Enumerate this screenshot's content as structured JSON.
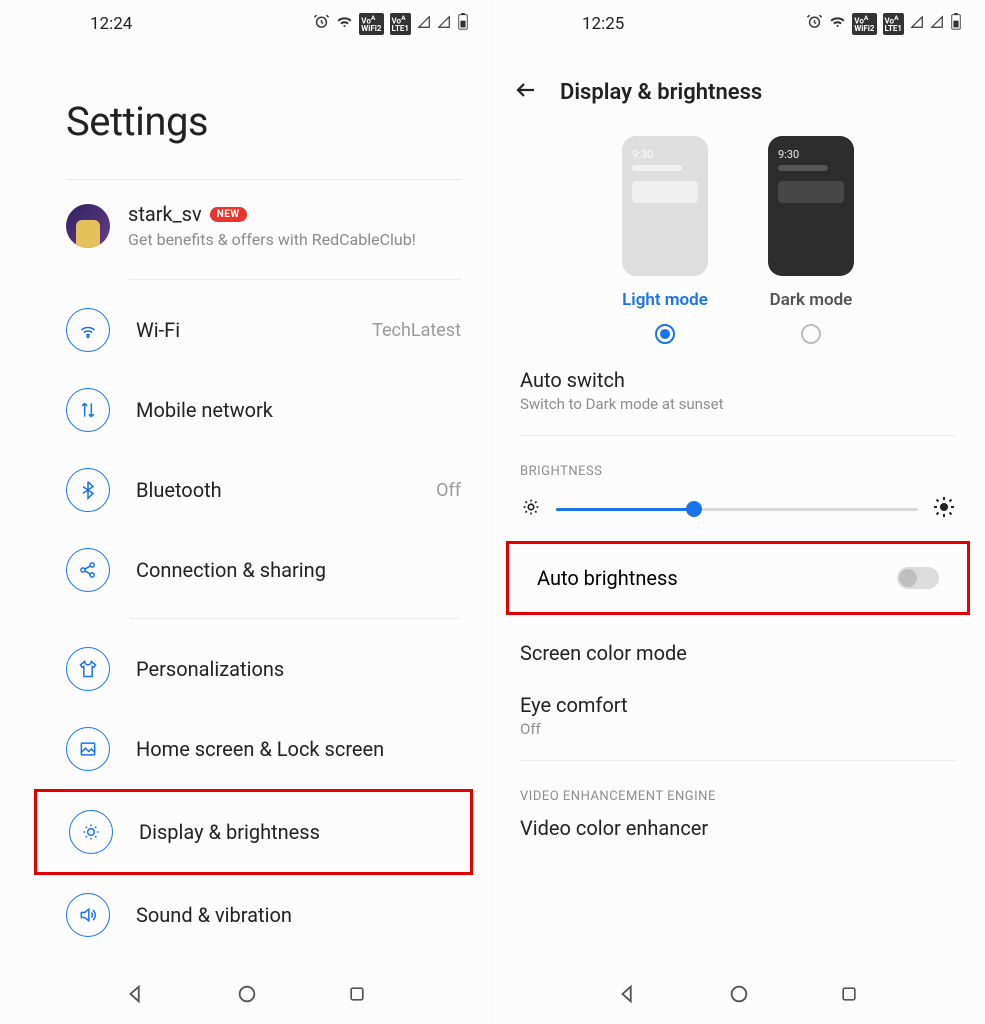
{
  "left": {
    "statusbar": {
      "time": "12:24",
      "badge1": "Vo^\nWiFi2",
      "badge2": "Vo^\nLTE1"
    },
    "title": "Settings",
    "account": {
      "username": "stark_sv",
      "new_badge": "NEW",
      "subtitle": "Get benefits & offers with RedCableClub!"
    },
    "items": [
      {
        "label": "Wi-Fi",
        "value": "TechLatest"
      },
      {
        "label": "Mobile network",
        "value": ""
      },
      {
        "label": "Bluetooth",
        "value": "Off"
      },
      {
        "label": "Connection & sharing",
        "value": ""
      },
      {
        "label": "Personalizations",
        "value": ""
      },
      {
        "label": "Home screen & Lock screen",
        "value": ""
      },
      {
        "label": "Display & brightness",
        "value": ""
      },
      {
        "label": "Sound & vibration",
        "value": ""
      }
    ]
  },
  "right": {
    "statusbar": {
      "time": "12:25",
      "badge1": "Vo^\nWiFi2",
      "badge2": "Vo^\nLTE1"
    },
    "header": "Display & brightness",
    "modes": {
      "light_time": "9:30",
      "dark_time": "9:30",
      "light_label": "Light mode",
      "dark_label": "Dark mode"
    },
    "auto_switch": {
      "title": "Auto switch",
      "sub": "Switch to Dark mode at sunset"
    },
    "brightness_label": "BRIGHTNESS",
    "auto_brightness": "Auto brightness",
    "screen_color": "Screen color mode",
    "eye_comfort": {
      "title": "Eye comfort",
      "sub": "Off"
    },
    "video_section": "VIDEO ENHANCEMENT ENGINE",
    "video_enhancer": "Video color enhancer"
  }
}
